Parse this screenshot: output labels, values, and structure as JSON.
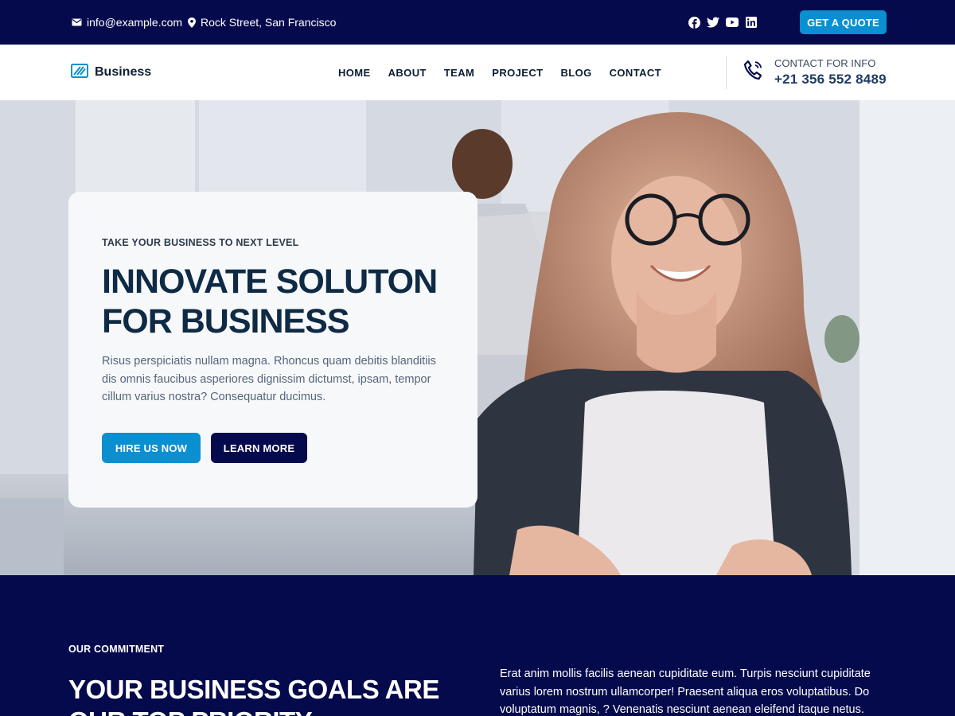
{
  "topbar": {
    "email": "info@example.com",
    "address": "Rock Street, San Francisco",
    "social_icons": [
      "facebook-icon",
      "twitter-icon",
      "youtube-icon",
      "linkedin-icon"
    ],
    "quote_label": "GET A QUOTE"
  },
  "header": {
    "brand": "Business",
    "nav": [
      "HOME",
      "ABOUT",
      "TEAM",
      "PROJECT",
      "BLOG",
      "CONTACT"
    ],
    "contact_label": "CONTACT FOR INFO",
    "contact_phone": "+21 356 552 8489"
  },
  "hero": {
    "kicker": "TAKE YOUR BUSINESS TO NEXT LEVEL",
    "title": "INNOVATE SOLUTON FOR BUSINESS",
    "description": "Risus perspiciatis nullam magna. Rhoncus quam debitis blanditiis dis omnis faucibus asperiores dignissim dictumst, ipsam, tempor cillum varius nostra? Consequatur ducimus.",
    "primary_button": "HIRE US NOW",
    "secondary_button": "LEARN MORE"
  },
  "commitment": {
    "eyebrow": "OUR COMMITMENT",
    "heading": "YOUR BUSINESS GOALS ARE OUR TOP PRIORITY",
    "paragraph": "Erat anim mollis facilis aenean cupiditate eum. Turpis nesciunt cupiditate varius lorem nostrum ullamcorper! Praesent aliqua eros voluptatibus. Do voluptatum magnis, ? Venenatis nesciunt aenean eleifend itaque netus."
  },
  "colors": {
    "navy": "#050a4d",
    "accent": "#0a8fd1",
    "heading": "#0e2a44"
  }
}
